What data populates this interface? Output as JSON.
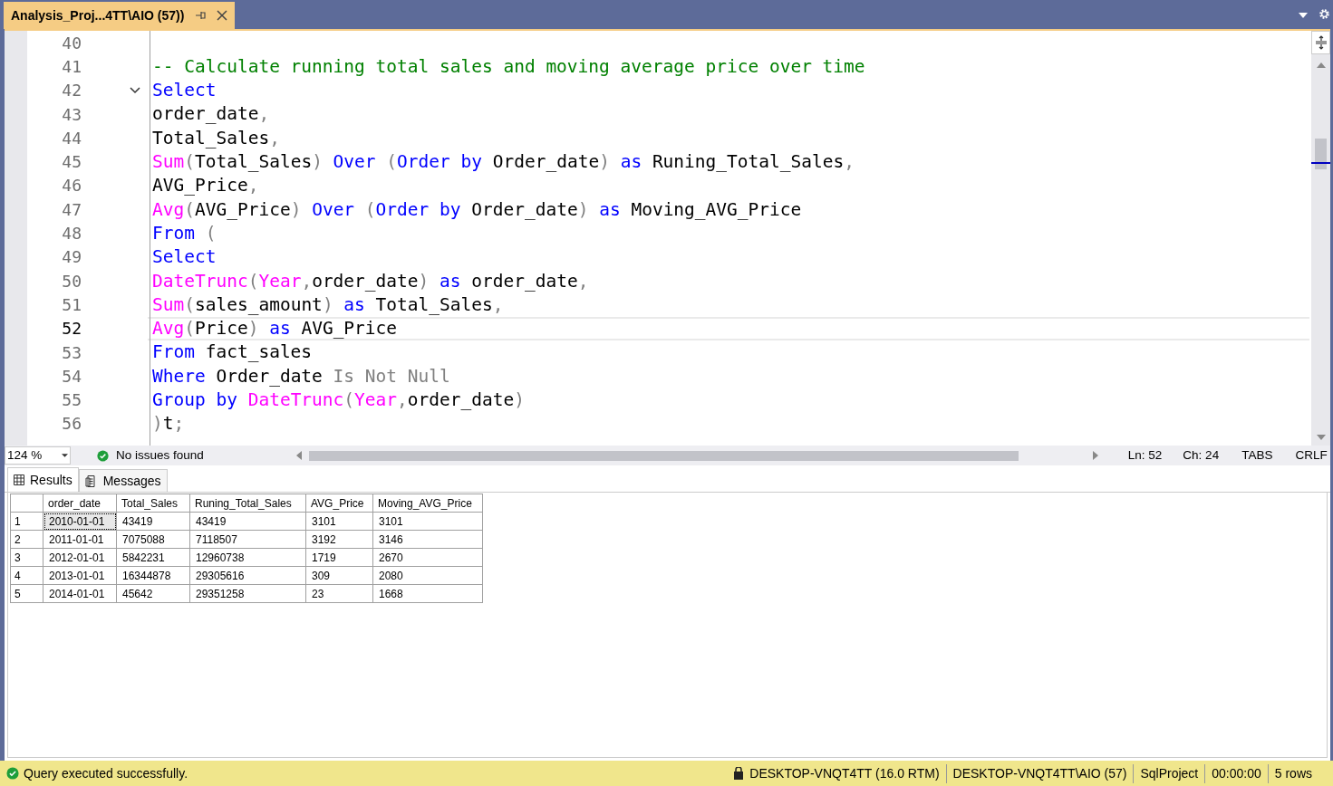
{
  "document_tab": {
    "title": "Analysis_Proj...4TT\\AIO (57))",
    "selected": true
  },
  "editor": {
    "lines": [
      {
        "number": "40",
        "current": false
      },
      {
        "number": "41",
        "current": false,
        "tokens": [
          {
            "kind": "comment",
            "text": "-- Calculate running total sales and moving average price over time"
          }
        ]
      },
      {
        "number": "42",
        "current": false,
        "fold": {
          "expanded": true
        },
        "tokens": [
          {
            "kind": "keyword",
            "text": "Select"
          }
        ]
      },
      {
        "number": "43",
        "current": false,
        "tokens": [
          {
            "kind": "ident",
            "text": "order_date"
          },
          {
            "kind": "punct",
            "text": ","
          }
        ]
      },
      {
        "number": "44",
        "current": false,
        "tokens": [
          {
            "kind": "ident",
            "text": "Total_Sales"
          },
          {
            "kind": "punct",
            "text": ","
          }
        ]
      },
      {
        "number": "45",
        "current": false,
        "tokens": [
          {
            "kind": "function",
            "text": "Sum"
          },
          {
            "kind": "punct",
            "text": "("
          },
          {
            "kind": "ident",
            "text": "Total_Sales"
          },
          {
            "kind": "punct",
            "text": ")"
          },
          {
            "kind": "keyword",
            "text": " Over "
          },
          {
            "kind": "punct",
            "text": "("
          },
          {
            "kind": "keyword",
            "text": "Order by "
          },
          {
            "kind": "ident",
            "text": "Order_date"
          },
          {
            "kind": "punct",
            "text": ")"
          },
          {
            "kind": "keyword",
            "text": " as "
          },
          {
            "kind": "ident",
            "text": "Runing_Total_Sales"
          },
          {
            "kind": "punct",
            "text": ","
          }
        ]
      },
      {
        "number": "46",
        "current": false,
        "tokens": [
          {
            "kind": "ident",
            "text": "AVG_Price"
          },
          {
            "kind": "punct",
            "text": ","
          }
        ]
      },
      {
        "number": "47",
        "current": false,
        "tokens": [
          {
            "kind": "function",
            "text": "Avg"
          },
          {
            "kind": "punct",
            "text": "("
          },
          {
            "kind": "ident",
            "text": "AVG_Price"
          },
          {
            "kind": "punct",
            "text": ")"
          },
          {
            "kind": "keyword",
            "text": " Over "
          },
          {
            "kind": "punct",
            "text": "("
          },
          {
            "kind": "keyword",
            "text": "Order by "
          },
          {
            "kind": "ident",
            "text": "Order_date"
          },
          {
            "kind": "punct",
            "text": ")"
          },
          {
            "kind": "keyword",
            "text": " as "
          },
          {
            "kind": "ident",
            "text": "Moving_AVG_Price"
          }
        ]
      },
      {
        "number": "48",
        "current": false,
        "tokens": [
          {
            "kind": "keyword",
            "text": "From "
          },
          {
            "kind": "punct",
            "text": "("
          }
        ]
      },
      {
        "number": "49",
        "current": false,
        "tokens": [
          {
            "kind": "keyword",
            "text": "Select"
          }
        ]
      },
      {
        "number": "50",
        "current": false,
        "tokens": [
          {
            "kind": "function",
            "text": "DateTrunc"
          },
          {
            "kind": "punct",
            "text": "("
          },
          {
            "kind": "function",
            "text": "Year"
          },
          {
            "kind": "punct",
            "text": ","
          },
          {
            "kind": "ident",
            "text": "order_date"
          },
          {
            "kind": "punct",
            "text": ")"
          },
          {
            "kind": "keyword",
            "text": " as "
          },
          {
            "kind": "ident",
            "text": "order_date"
          },
          {
            "kind": "punct",
            "text": ","
          }
        ]
      },
      {
        "number": "51",
        "current": false,
        "tokens": [
          {
            "kind": "function",
            "text": "Sum"
          },
          {
            "kind": "punct",
            "text": "("
          },
          {
            "kind": "ident",
            "text": "sales_amount"
          },
          {
            "kind": "punct",
            "text": ")"
          },
          {
            "kind": "keyword",
            "text": " as "
          },
          {
            "kind": "ident",
            "text": "Total_Sales"
          },
          {
            "kind": "punct",
            "text": ","
          }
        ]
      },
      {
        "number": "52",
        "current": true,
        "tokens": [
          {
            "kind": "function",
            "text": "Avg"
          },
          {
            "kind": "punct",
            "text": "("
          },
          {
            "kind": "ident",
            "text": "Price"
          },
          {
            "kind": "punct",
            "text": ")"
          },
          {
            "kind": "keyword",
            "text": " as "
          },
          {
            "kind": "ident",
            "text": "AVG_Price"
          }
        ]
      },
      {
        "number": "53",
        "current": false,
        "tokens": [
          {
            "kind": "keyword",
            "text": "From "
          },
          {
            "kind": "ident",
            "text": "fact_sales"
          }
        ]
      },
      {
        "number": "54",
        "current": false,
        "tokens": [
          {
            "kind": "keyword",
            "text": "Where "
          },
          {
            "kind": "ident",
            "text": "Order_date "
          },
          {
            "kind": "punct",
            "text": "Is Not Null"
          }
        ]
      },
      {
        "number": "55",
        "current": false,
        "tokens": [
          {
            "kind": "keyword",
            "text": "Group by "
          },
          {
            "kind": "function",
            "text": "DateTrunc"
          },
          {
            "kind": "punct",
            "text": "("
          },
          {
            "kind": "function",
            "text": "Year"
          },
          {
            "kind": "punct",
            "text": ","
          },
          {
            "kind": "ident",
            "text": "order_date"
          },
          {
            "kind": "punct",
            "text": ")"
          }
        ]
      },
      {
        "number": "56",
        "current": false,
        "tokens": [
          {
            "kind": "punct",
            "text": ")"
          },
          {
            "kind": "ident",
            "text": "t"
          },
          {
            "kind": "punct",
            "text": ";"
          }
        ]
      }
    ]
  },
  "editor_status": {
    "zoom": "124 %",
    "issues": "No issues found",
    "line": "Ln: 52",
    "column": "Ch: 24",
    "indent": "TABS",
    "line_ending": "CRLF"
  },
  "result_tabs": [
    {
      "label": "Results",
      "selected": true
    },
    {
      "label": "Messages",
      "selected": false
    }
  ],
  "results": {
    "columns": [
      "order_date",
      "Total_Sales",
      "Runing_Total_Sales",
      "AVG_Price",
      "Moving_AVG_Price"
    ],
    "rows": [
      {
        "number": "1",
        "selected": true,
        "cells": [
          "2010-01-01",
          "43419",
          "43419",
          "3101",
          "3101"
        ]
      },
      {
        "number": "2",
        "selected": false,
        "cells": [
          "2011-01-01",
          "7075088",
          "7118507",
          "3192",
          "3146"
        ]
      },
      {
        "number": "3",
        "selected": false,
        "cells": [
          "2012-01-01",
          "5842231",
          "12960738",
          "1719",
          "2670"
        ]
      },
      {
        "number": "4",
        "selected": false,
        "cells": [
          "2013-01-01",
          "16344878",
          "29305616",
          "309",
          "2080"
        ]
      },
      {
        "number": "5",
        "selected": false,
        "cells": [
          "2014-01-01",
          "45642",
          "29351258",
          "23",
          "1668"
        ]
      }
    ]
  },
  "status_bar": {
    "message": "Query executed successfully.",
    "server": "DESKTOP-VNQT4TT (16.0 RTM)",
    "login": "DESKTOP-VNQT4TT\\AIO (57)",
    "database": "SqlProject",
    "elapsed": "00:00:00",
    "row_count": "5 rows"
  }
}
